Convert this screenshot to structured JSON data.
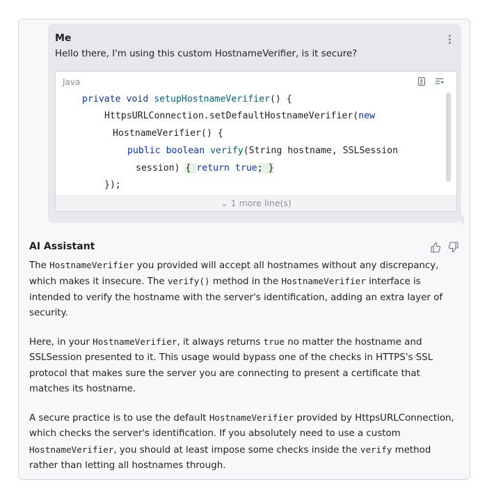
{
  "user_message": {
    "author": "Me",
    "text": "Hello there, I'm using this custom HostnameVerifier, is it secure?",
    "more_icon": "vertical-ellipsis-icon"
  },
  "code_block": {
    "language": "Java",
    "copy_icon": "copy-icon",
    "insert_icon": "insert-at-caret-icon",
    "lines": {
      "l1": {
        "t1": "private void ",
        "t2": "setupHostnameVerifier",
        "t3": "() {"
      },
      "l2": {
        "t1": "HttpsURLConnection.setDefaultHostnameVerifier(",
        "t2": "new"
      },
      "l3": {
        "t1": "HostnameVerifier() {"
      },
      "l4": {
        "t1": "public boolean ",
        "t2": "verify",
        "t3": "(String hostname, SSLSession"
      },
      "l5": {
        "t1": "session) ",
        "t2": "{ ",
        "t3": "return true",
        "t4": "; }"
      },
      "l6": {
        "t1": "});"
      }
    },
    "more_lines": "⌄ 1 more line(s)"
  },
  "assistant": {
    "author": "AI Assistant",
    "like_icon": "thumbs-up-icon",
    "dislike_icon": "thumbs-down-icon",
    "p1": {
      "a": "The ",
      "b": "HostnameVerifier",
      "c": " you provided will accept all hostnames without any discrepancy, which makes it insecure. The ",
      "d": "verify()",
      "e": " method in the ",
      "f": "HostnameVerifier",
      "g": " interface is intended to verify the hostname with the server's identification, adding an extra layer of security."
    },
    "p2": {
      "a": "Here, in your ",
      "b": "HostnameVerifier",
      "c": ", it always returns ",
      "d": "true",
      "e": " no matter the hostname and SSLSession presented to it. This usage would bypass one of the checks in HTTPS's SSL protocol that makes sure the server you are connecting to present a certificate that matches its hostname."
    },
    "p3": {
      "a": "A secure practice is to use the default ",
      "b": "HostnameVerifier",
      "c": " provided by HttpsURLConnection, which checks the server's identification. If you absolutely need to use a custom ",
      "d": "HostnameVerifier",
      "e": ", you should at least impose some checks inside the ",
      "f": "verify",
      "g": " method rather than letting all hostnames through."
    }
  }
}
